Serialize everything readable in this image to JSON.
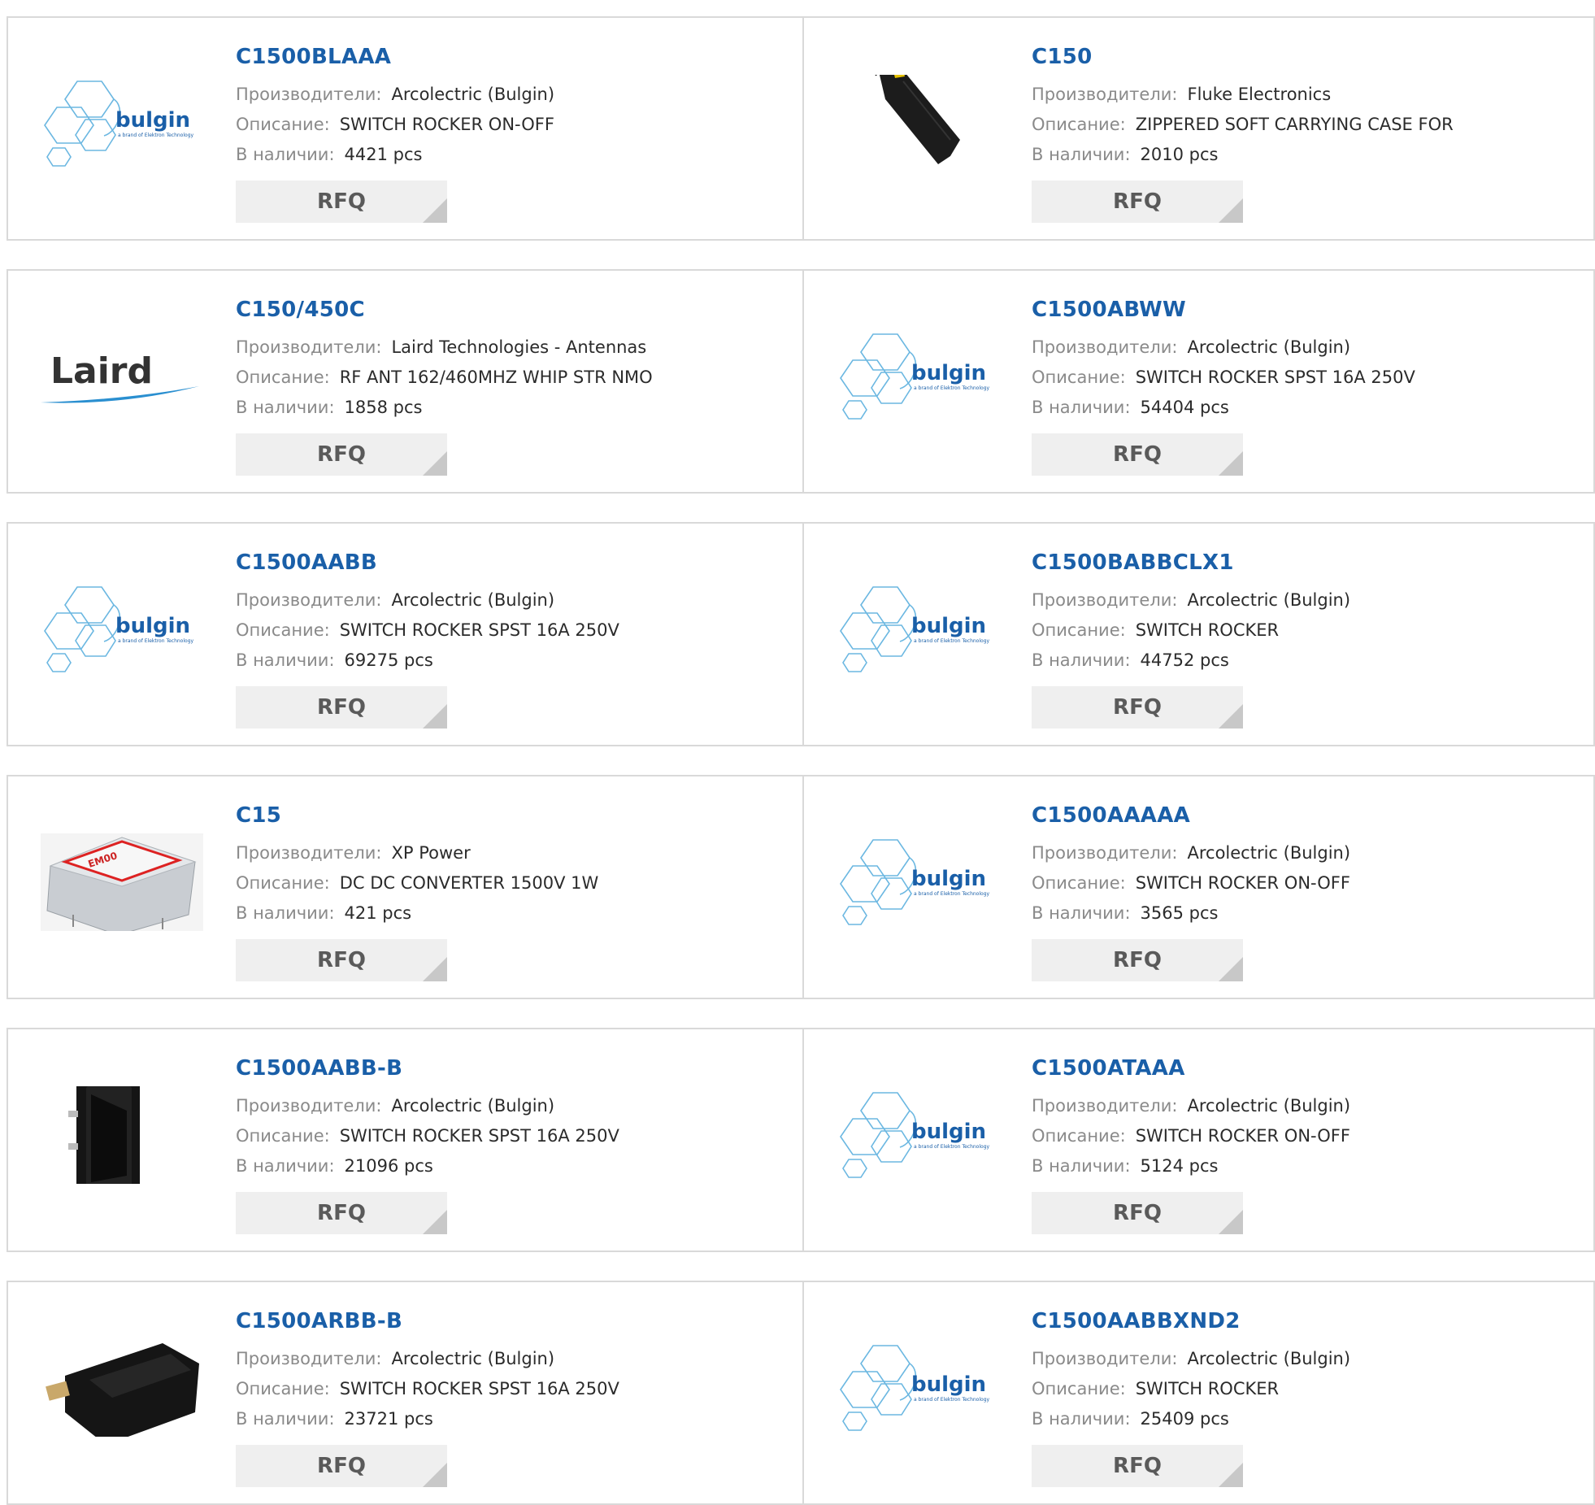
{
  "labels": {
    "manufacturer": "Производители:",
    "description": "Описание:",
    "stock": "В наличии:",
    "rfq": "RFQ"
  },
  "colors": {
    "link": "#1a5fa8",
    "border": "#d9d9d9",
    "button_bg": "#efefef",
    "logo_blue": "#3aa0d8"
  },
  "products": [
    {
      "part": "C1500BLAAA",
      "manufacturer": "Arcolectric (Bulgin)",
      "description": "SWITCH ROCKER ON-OFF",
      "stock": "4421 pcs",
      "image": "bulgin-logo",
      "logo_text": "bulgin",
      "logo_sub": "a brand of Elektron Technology"
    },
    {
      "part": "C150",
      "manufacturer": "Fluke Electronics",
      "description": "ZIPPERED SOFT CARRYING CASE FOR",
      "stock": "2010 pcs",
      "image": "carrying-case-photo"
    },
    {
      "part": "C150/450C",
      "manufacturer": "Laird Technologies - Antennas",
      "description": "RF ANT 162/460MHZ WHIP STR NMO",
      "stock": "1858 pcs",
      "image": "laird-logo",
      "logo_text": "Laird"
    },
    {
      "part": "C1500ABWW",
      "manufacturer": "Arcolectric (Bulgin)",
      "description": "SWITCH ROCKER SPST 16A 250V",
      "stock": "54404 pcs",
      "image": "bulgin-logo",
      "logo_text": "bulgin",
      "logo_sub": "a brand of Elektron Technology"
    },
    {
      "part": "C1500AABB",
      "manufacturer": "Arcolectric (Bulgin)",
      "description": "SWITCH ROCKER SPST 16A 250V",
      "stock": "69275 pcs",
      "image": "bulgin-logo",
      "logo_text": "bulgin",
      "logo_sub": "a brand of Elektron Technology"
    },
    {
      "part": "C1500BABBCLX1",
      "manufacturer": "Arcolectric (Bulgin)",
      "description": "SWITCH ROCKER",
      "stock": "44752 pcs",
      "image": "bulgin-logo",
      "logo_text": "bulgin",
      "logo_sub": "a brand of Elektron Technology"
    },
    {
      "part": "C15",
      "manufacturer": "XP Power",
      "description": "DC DC CONVERTER 1500V 1W",
      "stock": "421 pcs",
      "image": "converter-photo"
    },
    {
      "part": "C1500AAAAA",
      "manufacturer": "Arcolectric (Bulgin)",
      "description": "SWITCH ROCKER ON-OFF",
      "stock": "3565 pcs",
      "image": "bulgin-logo",
      "logo_text": "bulgin",
      "logo_sub": "a brand of Elektron Technology"
    },
    {
      "part": "C1500AABB-B",
      "manufacturer": "Arcolectric (Bulgin)",
      "description": "SWITCH ROCKER SPST 16A 250V",
      "stock": "21096 pcs",
      "image": "rocker-switch-photo"
    },
    {
      "part": "C1500ATAAA",
      "manufacturer": "Arcolectric (Bulgin)",
      "description": "SWITCH ROCKER ON-OFF",
      "stock": "5124 pcs",
      "image": "bulgin-logo",
      "logo_text": "bulgin",
      "logo_sub": "a brand of Elektron Technology"
    },
    {
      "part": "C1500ARBB-B",
      "manufacturer": "Arcolectric (Bulgin)",
      "description": "SWITCH ROCKER SPST 16A 250V",
      "stock": "23721 pcs",
      "image": "rocker-switch-angled-photo"
    },
    {
      "part": "C1500AABBXND2",
      "manufacturer": "Arcolectric (Bulgin)",
      "description": "SWITCH ROCKER",
      "stock": "25409 pcs",
      "image": "bulgin-logo",
      "logo_text": "bulgin",
      "logo_sub": "a brand of Elektron Technology"
    }
  ]
}
